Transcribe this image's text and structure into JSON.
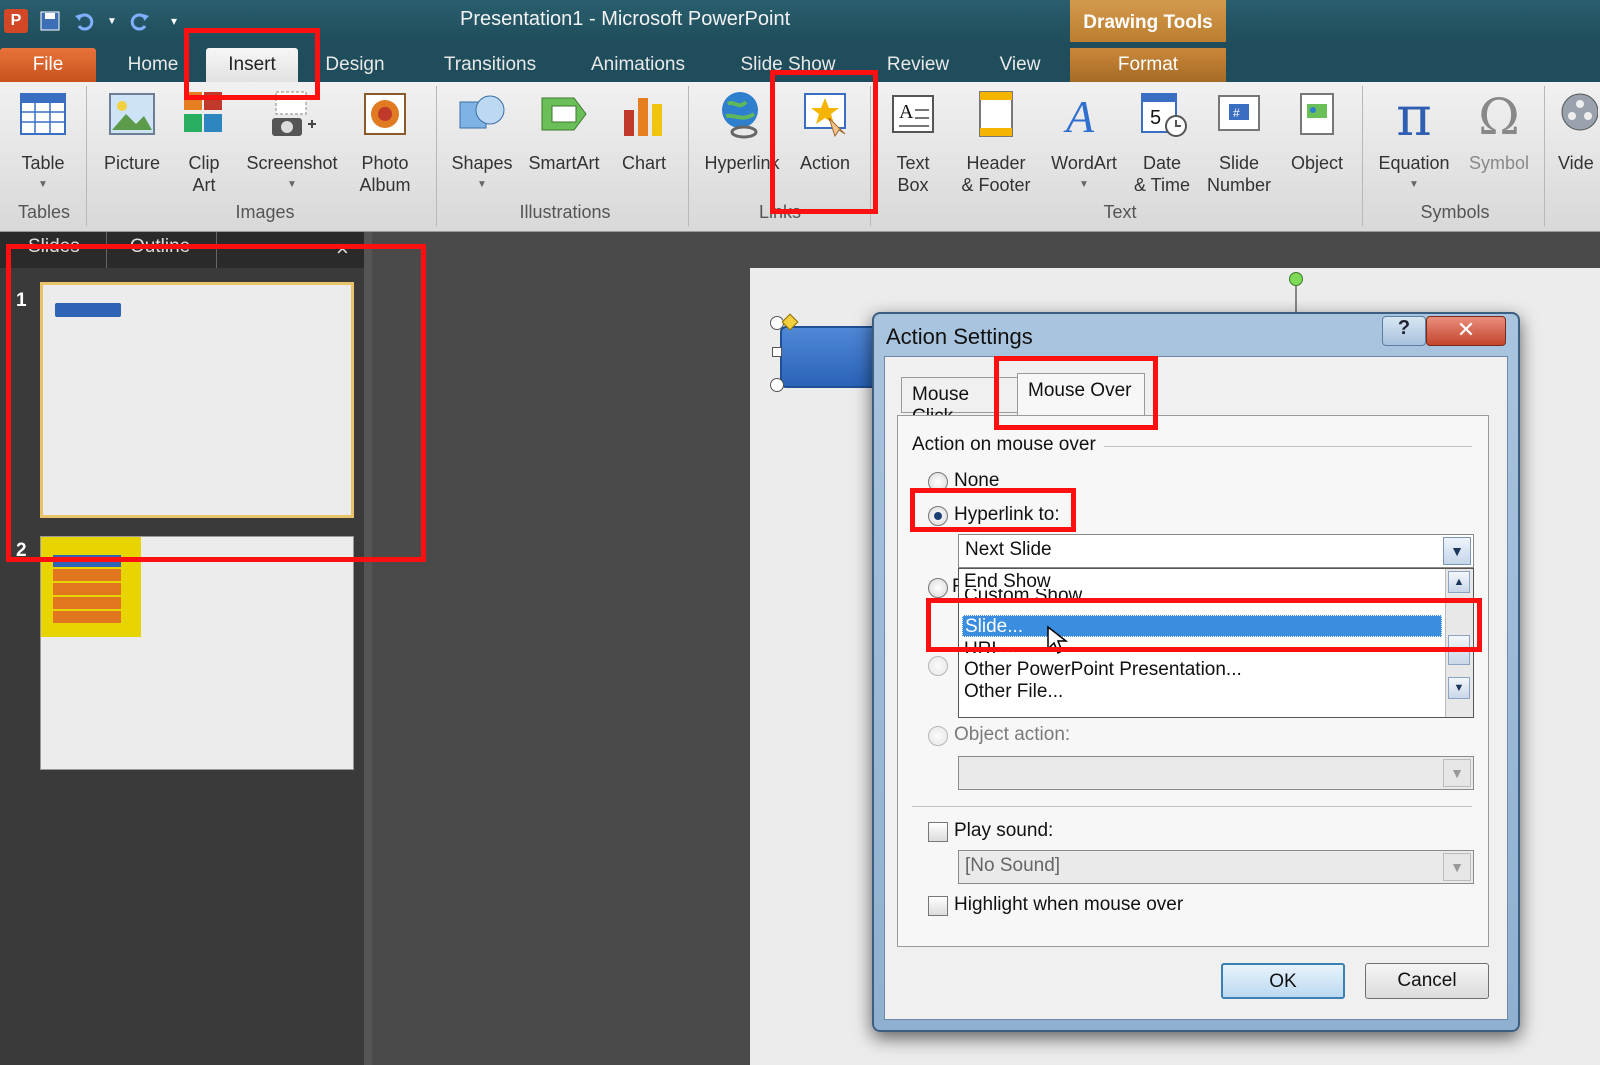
{
  "window": {
    "title": "Presentation1  -  Microsoft PowerPoint",
    "contextual_tab_group": "Drawing Tools"
  },
  "qat": {
    "logo_letter": "P",
    "save_icon": "save-icon",
    "undo_icon": "undo-icon",
    "redo_icon": "redo-icon"
  },
  "tabs": [
    {
      "label": "File"
    },
    {
      "label": "Home"
    },
    {
      "label": "Insert"
    },
    {
      "label": "Design"
    },
    {
      "label": "Transitions"
    },
    {
      "label": "Animations"
    },
    {
      "label": "Slide Show"
    },
    {
      "label": "Review"
    },
    {
      "label": "View"
    },
    {
      "label": "Format"
    }
  ],
  "ribbon": {
    "groups": {
      "tables": "Tables",
      "images": "Images",
      "illustrations": "Illustrations",
      "links": "Links",
      "text": "Text",
      "symbols": "Symbols"
    },
    "buttons": {
      "table": "Table",
      "picture": "Picture",
      "clip_art_1": "Clip",
      "clip_art_2": "Art",
      "screenshot": "Screenshot",
      "photo_album_1": "Photo",
      "photo_album_2": "Album",
      "shapes": "Shapes",
      "smartart": "SmartArt",
      "chart": "Chart",
      "hyperlink": "Hyperlink",
      "action": "Action",
      "text_box_1": "Text",
      "text_box_2": "Box",
      "header_footer_1": "Header",
      "header_footer_2": "& Footer",
      "wordart": "WordArt",
      "date_time_1": "Date",
      "date_time_2": "& Time",
      "slide_number_1": "Slide",
      "slide_number_2": "Number",
      "object": "Object",
      "equation": "Equation",
      "symbol": "Symbol",
      "video": "Vide"
    }
  },
  "slide_pane": {
    "tabs": [
      "Slides",
      "Outline"
    ],
    "close_glyph": "×",
    "slides": [
      {
        "number": "1"
      },
      {
        "number": "2"
      }
    ]
  },
  "dialog": {
    "title": "Action Settings",
    "help_glyph": "?",
    "close_glyph": "✕",
    "tabs": [
      "Mouse Click",
      "Mouse Over"
    ],
    "active_tab": "Mouse Over",
    "section_label": "Action on mouse over",
    "options": {
      "none": "None",
      "hyperlink_to": "Hyperlink to:",
      "run_program_initial": "R",
      "object_action": "Object action:"
    },
    "hyperlink_value": "Next Slide",
    "dropdown_items": [
      "End Show",
      "Custom Show...",
      "Slide...",
      "URL...",
      "Other PowerPoint Presentation...",
      "Other File..."
    ],
    "selected_dropdown_item": "Slide...",
    "play_sound_label": "Play sound:",
    "sound_value": "[No Sound]",
    "highlight_label": "Highlight when mouse over",
    "ok_label": "OK",
    "cancel_label": "Cancel"
  },
  "colors": {
    "annotation": "#ff1010",
    "selection": "#3b8de0",
    "file_tab": "#d9622b",
    "drawing_tools": "#c98a3a"
  }
}
